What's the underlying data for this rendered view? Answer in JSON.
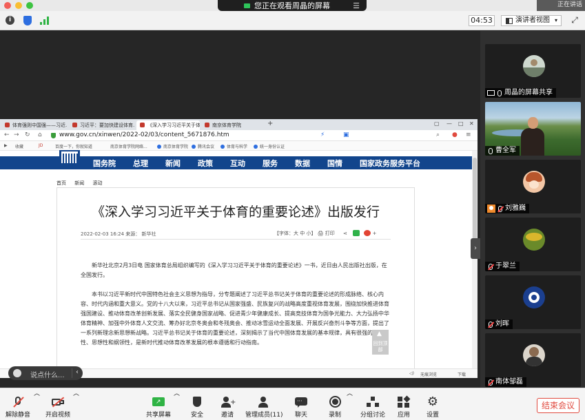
{
  "topbar": {
    "viewing_text": "您正在观看周晶的屏幕",
    "corner_text": "正在讲话"
  },
  "inforow": {
    "timer": "04:53",
    "view_mode": "演讲者视图"
  },
  "browser": {
    "tabs": [
      {
        "label": "体育强则中国强——习近..."
      },
      {
        "label": "习近平：要加快建设体育..."
      },
      {
        "label": "《深入学习习近平关于体..."
      },
      {
        "label": "南京体育学院"
      }
    ],
    "url": "www.gov.cn/xinwen/2022-02/03/content_5671876.htm",
    "bookmarks": [
      "收藏",
      "JD",
      "百度一下，你就知道",
      "南京体育学院网络...",
      "南京体育学院",
      "腾讯会议",
      "体育与科学",
      "统一身份认证"
    ],
    "status_items": [
      "无痕浏览",
      "下载"
    ]
  },
  "site": {
    "nav": [
      "国务院",
      "总理",
      "新闻",
      "政策",
      "互动",
      "服务",
      "数据",
      "国情",
      "国家政务服务平台"
    ],
    "breadcrumb": [
      "首页",
      "新闻",
      "滚动"
    ],
    "title": "《深入学习习近平关于体育的重要论述》出版发行",
    "meta": "2022-02-03 16:24   来源：  新华社",
    "tools": "【字体：大  中  小】   🖨 打印",
    "paragraphs": [
      "新华社北京2月3日电  国家体育总局组织编写的《深入学习习近平关于体育的重要论述》一书，近日由人民出版社出版，在全国发行。",
      "本书以习近平新时代中国特色社会主义思想为指导，分专题阐述了习近平总书记关于体育的重要论述的形成脉络、核心内容、时代内涵和重大意义。党的十八大以来，习近平总书记从国家强盛、民族复兴的战略高度重视体育发展，围绕加快推进体育强国建设、推动体育改革创新发展、落实全民健身国家战略、促进青少年健康成长、提高竞技体育为国争光能力、大力弘扬中华体育精神、加强中外体育人文交流、筹办好北京冬奥会和冬残奥会、推动冰雪运动全面发展、开展反兴奋剂斗争等方面，提出了一系列新理念新思想新战略。习近平总书记关于体育的重要论述，深刻揭示了当代中国体育发展的基本规律，具有很强的战略性、思想性和纲领性，是新时代推动体育改革发展的根本遵循和行动指南。"
    ],
    "back_to_top": "回到顶部"
  },
  "chat": {
    "placeholder": "说点什么..."
  },
  "participants": [
    {
      "name": "周晶的屏幕共享"
    },
    {
      "name": "曹全军"
    },
    {
      "name": "刘雅巍"
    },
    {
      "name": "于翠兰"
    },
    {
      "name": "刘晖"
    },
    {
      "name": "南体邹磊"
    }
  ],
  "toolbar": {
    "mute": "解除静音",
    "video": "开启视频",
    "share": "共享屏幕",
    "security": "安全",
    "invite": "邀请",
    "members": "管理成员(11)",
    "chat": "聊天",
    "record": "录制",
    "breakout": "分组讨论",
    "apps": "应用",
    "settings": "设置",
    "end": "结束会议"
  },
  "colors": {
    "gov_blue": "#12458c",
    "end_red": "#e04a3f",
    "signal_green": "#2fb344"
  }
}
